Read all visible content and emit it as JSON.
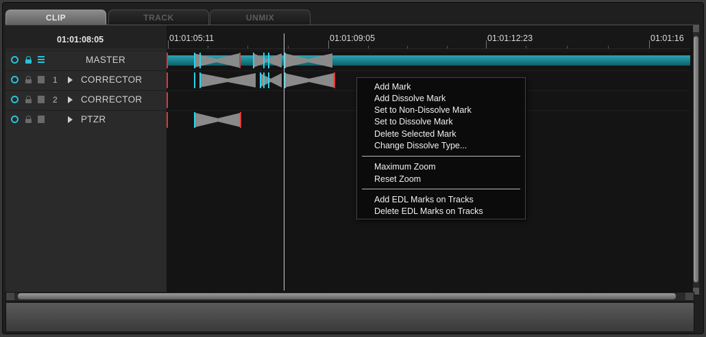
{
  "tabs": [
    {
      "label": "CLIP",
      "active": true
    },
    {
      "label": "TRACK",
      "active": false
    },
    {
      "label": "UNMIX",
      "active": false
    }
  ],
  "current_timecode": "01:01:08:05",
  "ruler_labels": [
    "01:01:05:11",
    "01:01:09:05",
    "01:01:12:23",
    "01:01:16"
  ],
  "tracks": [
    {
      "number": "",
      "label": "MASTER",
      "enabled": true,
      "locked": true
    },
    {
      "number": "1",
      "label": "CORRECTOR",
      "enabled": true,
      "locked": false
    },
    {
      "number": "2",
      "label": "CORRECTOR",
      "enabled": true,
      "locked": false
    },
    {
      "number": "",
      "label": "PTZR",
      "enabled": true,
      "locked": false
    }
  ],
  "context_menu": {
    "group1": [
      "Add Mark",
      "Add Dissolve Mark",
      "Set to Non-Dissolve Mark",
      "Set to Dissolve Mark",
      "Delete Selected Mark",
      "Change Dissolve Type..."
    ],
    "group2": [
      "Maximum Zoom",
      "Reset Zoom"
    ],
    "group3": [
      "Add EDL Marks on Tracks",
      "Delete EDL Marks on Tracks"
    ]
  },
  "colors": {
    "accent": "#27c4d8",
    "mark_red": "#e23838",
    "background": "#141414"
  },
  "icons": [
    "enable-ring-icon",
    "lock-icon",
    "track-lines-icon",
    "expand-triangle-icon"
  ]
}
